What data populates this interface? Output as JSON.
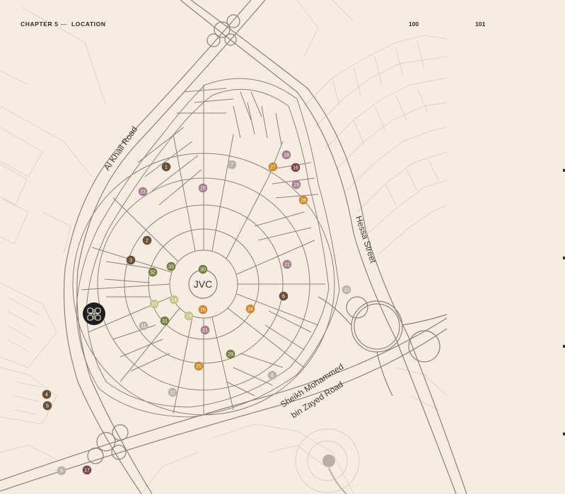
{
  "header": {
    "chapter": "CHAPTER 5",
    "separator": "—",
    "section": "LOCATION",
    "page_left": "100",
    "page_right": "101"
  },
  "map": {
    "center_label": "JVC",
    "roads": {
      "al_khail": "Al Khail Road",
      "hessa": "Hessa Street",
      "szr_line1": "Sheikh Mohammed",
      "szr_line2": "bin Zayed Road"
    },
    "colors": {
      "background": "#f5ede2",
      "road": "#8a8278",
      "plot": "#ddd4c7",
      "dark_brown": "#6b5038",
      "olive": "#76803e",
      "light_olive": "#c3c78a",
      "orange": "#cd8a2e",
      "mauve": "#a87f8f",
      "gray": "#bab4a9",
      "burgundy": "#7a4751",
      "marker": "#1e1e1e"
    },
    "pois": [
      {
        "n": "1",
        "color": "dark_brown"
      },
      {
        "n": "2",
        "color": "dark_brown"
      },
      {
        "n": "3",
        "color": "dark_brown"
      },
      {
        "n": "4",
        "color": "dark_brown"
      },
      {
        "n": "5",
        "color": "dark_brown"
      },
      {
        "n": "6",
        "color": "dark_brown"
      },
      {
        "n": "7",
        "color": "gray"
      },
      {
        "n": "8",
        "color": "gray"
      },
      {
        "n": "9",
        "color": "gray"
      },
      {
        "n": "10",
        "color": "gray"
      },
      {
        "n": "11",
        "color": "gray"
      },
      {
        "n": "12",
        "color": "gray"
      },
      {
        "n": "13",
        "color": "light_olive"
      },
      {
        "n": "14",
        "color": "light_olive"
      },
      {
        "n": "15",
        "color": "light_olive"
      },
      {
        "n": "16",
        "color": "burgundy"
      },
      {
        "n": "17",
        "color": "burgundy"
      },
      {
        "n": "18",
        "color": "mauve"
      },
      {
        "n": "19",
        "color": "mauve"
      },
      {
        "n": "20",
        "color": "mauve"
      },
      {
        "n": "21",
        "color": "mauve"
      },
      {
        "n": "22",
        "color": "mauve"
      },
      {
        "n": "23",
        "color": "mauve"
      },
      {
        "n": "24",
        "color": "orange"
      },
      {
        "n": "25",
        "color": "orange"
      },
      {
        "n": "26",
        "color": "orange"
      },
      {
        "n": "27",
        "color": "orange"
      },
      {
        "n": "28",
        "color": "orange"
      },
      {
        "n": "29",
        "color": "olive"
      },
      {
        "n": "30",
        "color": "olive"
      },
      {
        "n": "31",
        "color": "olive"
      },
      {
        "n": "32",
        "color": "olive"
      },
      {
        "n": "33",
        "color": "olive"
      }
    ]
  }
}
